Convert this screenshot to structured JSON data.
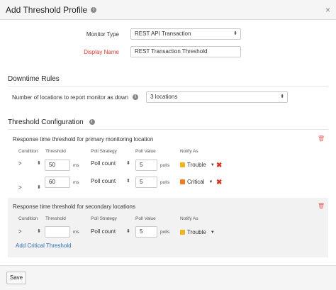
{
  "dialog": {
    "title": "Add Threshold Profile",
    "close_glyph": "×"
  },
  "form": {
    "monitor_type_label": "Monitor Type",
    "monitor_type_value": "REST API Transaction",
    "display_name_label": "Display Name",
    "display_name_value": "REST Transaction Threshold"
  },
  "downtime": {
    "title": "Downtime Rules",
    "locations_label": "Number of locations to report monitor as down",
    "locations_value": "3 locations"
  },
  "threshold": {
    "title": "Threshold Configuration",
    "columns": [
      "Condition",
      "Threshold",
      "Poll Strategy",
      "Poll Value",
      "Notify As"
    ],
    "unit_ms": "ms",
    "unit_polls": "polls",
    "primary": {
      "title": "Response time threshold for primary monitoring location",
      "rows": [
        {
          "condition": ">",
          "threshold": "50",
          "strategy": "Poll count",
          "poll_value": "5",
          "notify": "Trouble",
          "color": "#f0b323"
        },
        {
          "condition": ">",
          "threshold": "60",
          "strategy": "Poll count",
          "poll_value": "5",
          "notify": "Critical",
          "color": "#ef7d22"
        }
      ]
    },
    "secondary": {
      "title": "Response time threshold for secondary locations",
      "rows": [
        {
          "condition": ">",
          "threshold": "",
          "strategy": "Poll count",
          "poll_value": "5",
          "notify": "Trouble",
          "color": "#f0b323"
        }
      ],
      "add_link": "Add Critical Threshold"
    }
  },
  "footer": {
    "save_label": "Save"
  },
  "icons": {
    "info": "info-icon",
    "trash": "trash-icon",
    "delete": "delete-icon"
  }
}
